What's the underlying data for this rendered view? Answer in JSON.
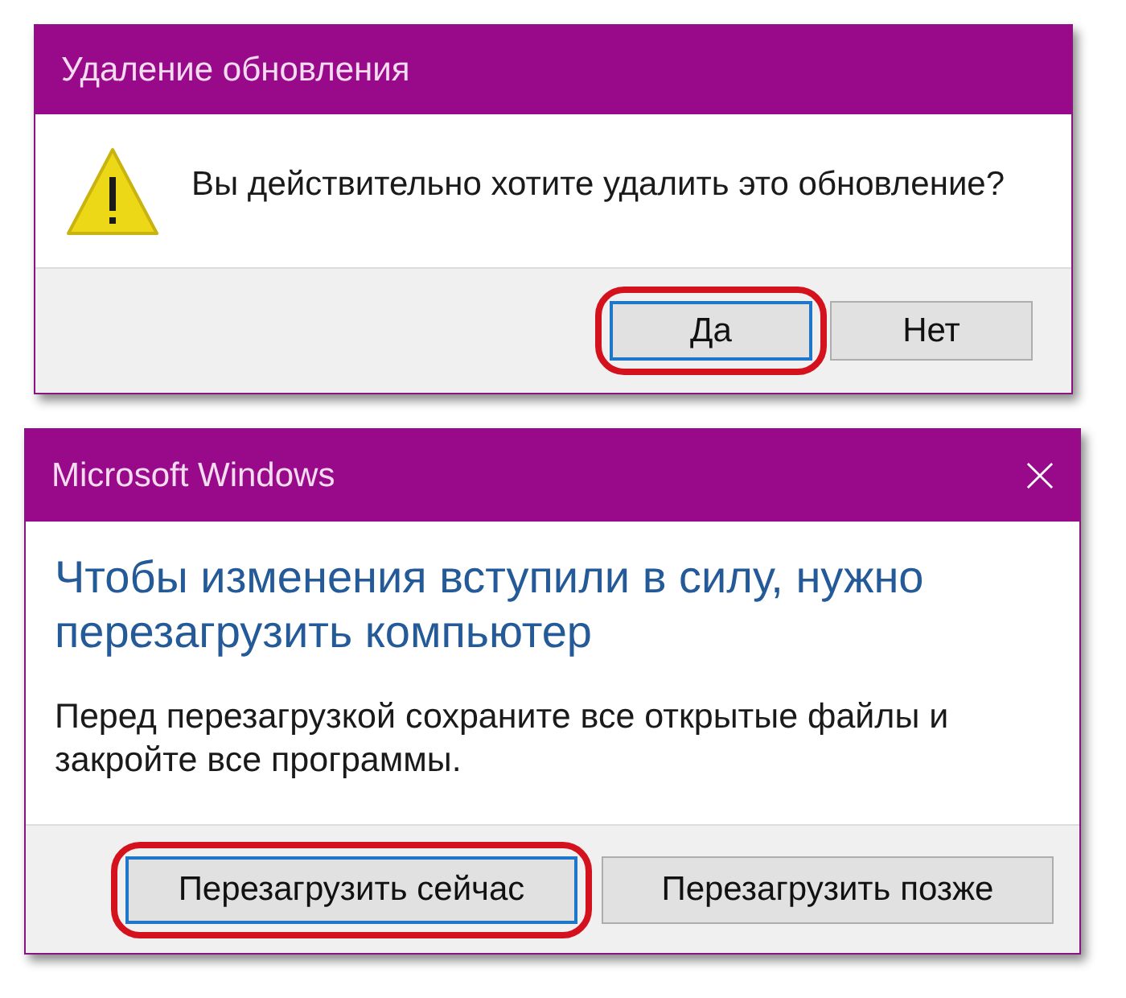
{
  "dialogs": [
    {
      "kind": "warning",
      "title": "Удаление обновления",
      "message": "Вы действительно хотите удалить это обновление?",
      "buttons": [
        {
          "label": "Да",
          "selected": true,
          "highlighted": true
        },
        {
          "label": "Нет",
          "selected": false,
          "highlighted": false
        }
      ]
    },
    {
      "kind": "info",
      "title": "Microsoft Windows",
      "close_button": true,
      "heading": "Чтобы изменения вступили в силу, нужно перезагрузить компьютер",
      "message": "Перед перезагрузкой сохраните все открытые файлы и закройте все программы.",
      "buttons": [
        {
          "label": "Перезагрузить сейчас",
          "selected": true,
          "highlighted": true
        },
        {
          "label": "Перезагрузить позже",
          "selected": false,
          "highlighted": false
        }
      ]
    }
  ]
}
